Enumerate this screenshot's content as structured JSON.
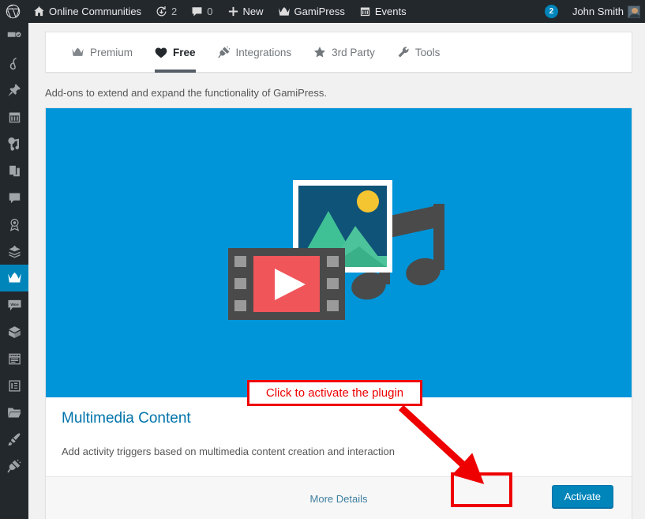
{
  "adminbar": {
    "logo_icon": "wordpress-logo-icon",
    "site_icon": "home-icon",
    "site_name": "Online Communities",
    "updates_icon": "updates-icon",
    "updates_count": "2",
    "comments_icon": "comment-icon",
    "comments_count": "0",
    "new_icon": "plus-icon",
    "new_label": "New",
    "gamipress_icon": "crown-icon",
    "gamipress_label": "GamiPress",
    "events_icon": "calendar-icon",
    "events_label": "Events",
    "notifications_count": "2",
    "user_name": "John Smith",
    "avatar_icon": "avatar-icon"
  },
  "sidebar": {
    "items": [
      {
        "name": "dashboard",
        "icon": "dashboard-icon",
        "active": false
      },
      {
        "name": "buddypress",
        "icon": "buddypress-icon",
        "active": false
      },
      {
        "name": "posts",
        "icon": "pin-icon",
        "active": false
      },
      {
        "name": "events",
        "icon": "calendar-icon",
        "active": false
      },
      {
        "name": "media",
        "icon": "media-icon",
        "active": false
      },
      {
        "name": "pages",
        "icon": "pages-icon",
        "active": false
      },
      {
        "name": "comments",
        "icon": "comment-icon",
        "active": false
      },
      {
        "name": "badges",
        "icon": "award-icon",
        "active": false
      },
      {
        "name": "ranks",
        "icon": "layers-icon",
        "active": false
      },
      {
        "name": "gamipress",
        "icon": "crown-icon",
        "active": true
      },
      {
        "name": "woocommerce",
        "icon": "woo-icon",
        "active": false
      },
      {
        "name": "products",
        "icon": "box-icon",
        "active": false
      },
      {
        "name": "forms",
        "icon": "form-icon",
        "active": false
      },
      {
        "name": "elementor",
        "icon": "list-icon",
        "active": false
      },
      {
        "name": "media-folders",
        "icon": "folder-icon",
        "active": false
      },
      {
        "name": "appearance",
        "icon": "brush-icon",
        "active": false
      },
      {
        "name": "plugins",
        "icon": "plug-icon",
        "active": false
      }
    ]
  },
  "tabs": [
    {
      "label": "Premium",
      "icon": "crown-icon",
      "active": false
    },
    {
      "label": "Free",
      "icon": "heart-icon",
      "active": true
    },
    {
      "label": "Integrations",
      "icon": "plug-icon",
      "active": false
    },
    {
      "label": "3rd Party",
      "icon": "star-icon",
      "active": false
    },
    {
      "label": "Tools",
      "icon": "wrench-icon",
      "active": false
    }
  ],
  "main": {
    "subtitle": "Add-ons to extend and expand the functionality of GamiPress.",
    "card": {
      "banner_illustration": "multimedia-illustration",
      "title": "Multimedia Content",
      "description": "Add activity triggers based on multimedia content creation and interaction",
      "more_details_label": "More Details",
      "activate_label": "Activate"
    }
  },
  "annotation": {
    "callout_text": "Click to activate the plugin",
    "arrow": "red-arrow",
    "highlight": "activate-button-highlight"
  },
  "colors": {
    "adminbar_bg": "#23282d",
    "page_bg": "#f1f1f1",
    "banner_blue": "#0095d9",
    "button_blue": "#0085ba",
    "link_blue": "#0073aa",
    "annotation_red": "#ee0000"
  }
}
